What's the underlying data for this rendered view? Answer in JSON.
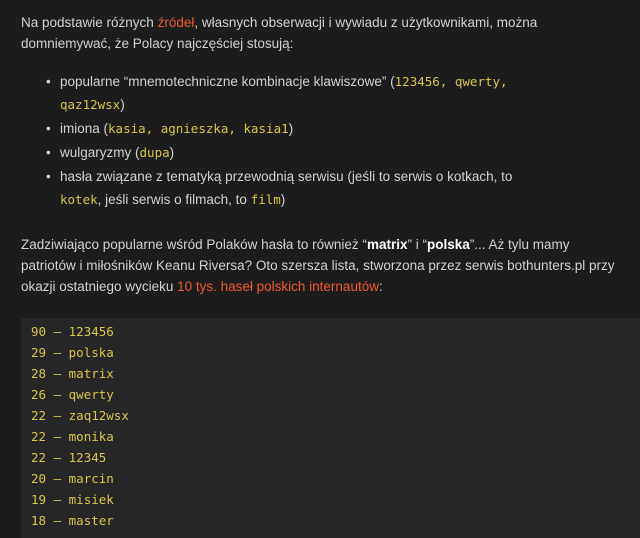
{
  "intro": {
    "before": "Na podstawie różnych ",
    "link": "źródeł",
    "after": ", własnych obserwacji i wywiadu z użytkownikami, można domniemywać, że Polacy najczęściej stosują:"
  },
  "bullets": {
    "symbol": "•",
    "item1": {
      "text_before": "popularne “mnemotechniczne kombinacje klawiszowe” (",
      "code_a": "123456, qwerty,",
      "code_b": "qaz12wsx",
      "text_after": ")"
    },
    "item2": {
      "text_before": "imiona (",
      "code": "kasia, agnieszka, kasia1",
      "text_after": ")"
    },
    "item3": {
      "text_before": "wulgaryzmy (",
      "code": "dupa",
      "text_after": ")"
    },
    "item4": {
      "text_before": "hasła związane z tematyką przewodnią serwisu (jeśli to serwis o kotkach, to",
      "code1": "kotek",
      "text_middle": ", jeśli serwis o filmach, to ",
      "code2": "film",
      "text_after": ")"
    }
  },
  "paragraph2": {
    "t1": "Zadziwiająco popularne wśród Polaków hasła to również “",
    "strong1": "matrix",
    "t2": "” i “",
    "strong2": "polska",
    "t3": "”... Aż tylu mamy patriotów i miłośników Keanu Riversa? Oto szersza lista, stworzona przez serwis bothunters.pl przy okazji ostatniego wycieku ",
    "link": "10 tys. haseł polskich internautów",
    "t4": ":"
  },
  "password_list": [
    {
      "count": "90",
      "password": "123456"
    },
    {
      "count": "29",
      "password": "polska"
    },
    {
      "count": "28",
      "password": "matrix"
    },
    {
      "count": "26",
      "password": "qwerty"
    },
    {
      "count": "22",
      "password": "zaq12wsx"
    },
    {
      "count": "22",
      "password": "monika"
    },
    {
      "count": "22",
      "password": "12345"
    },
    {
      "count": "20",
      "password": "marcin"
    },
    {
      "count": "19",
      "password": "misiek"
    },
    {
      "count": "18",
      "password": "master"
    }
  ],
  "list_separator": "—",
  "colors": {
    "background": "#1c1c1c",
    "text": "#d2d2d2",
    "link": "#ef5a32",
    "code": "#d8c645",
    "code_block_bg": "#262626"
  }
}
